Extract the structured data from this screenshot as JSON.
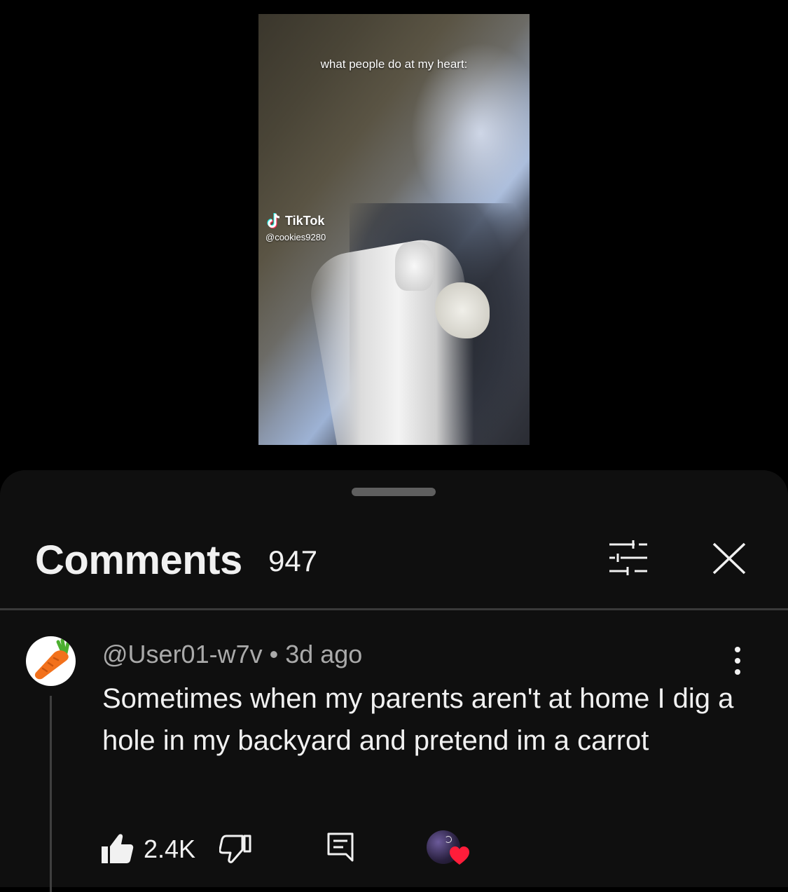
{
  "video": {
    "caption": "what people do at my heart:",
    "watermark_brand": "TikTok",
    "watermark_handle": "@cookies9280"
  },
  "comments": {
    "title": "Comments",
    "count": "947",
    "filter_icon": "filter-sliders-icon",
    "close_icon": "close-icon"
  },
  "comment": {
    "author": "@User01-w7v",
    "separator": "•",
    "time": "3d ago",
    "text": "Sometimes when my parents aren't at home I dig a hole in my backyard and pretend im a carrot",
    "avatar_icon": "carrot-icon",
    "likes": "2.4K",
    "creator_heart": true
  },
  "colors": {
    "sheet_bg": "#0f0f0f",
    "text": "#f1f1f1",
    "secondary": "#aaaaaa",
    "heart": "#ff1d3a"
  }
}
